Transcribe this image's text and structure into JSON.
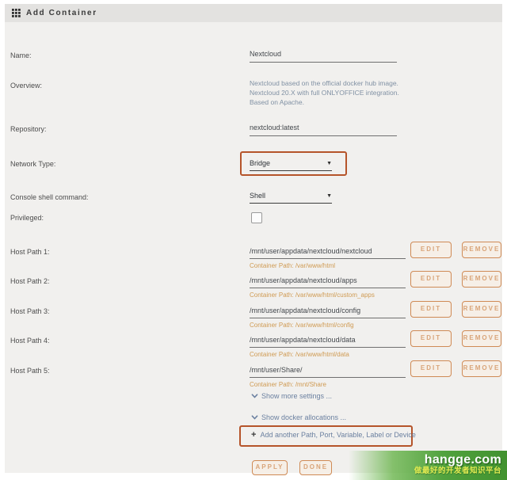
{
  "header": {
    "title": "Add Container"
  },
  "form": {
    "name": {
      "label": "Name:",
      "value": "Nextcloud"
    },
    "overview": {
      "label": "Overview:",
      "value": "Nextcloud based on the official docker hub image. Nextcloud 20.X with full ONLYOFFICE integration. Based on Apache."
    },
    "repository": {
      "label": "Repository:",
      "value": "nextcloud:latest"
    },
    "network_type": {
      "label": "Network Type:",
      "value": "Bridge"
    },
    "console_shell": {
      "label": "Console shell command:",
      "value": "Shell"
    },
    "privileged": {
      "label": "Privileged:",
      "checked": false
    }
  },
  "host_paths": [
    {
      "label": "Host Path 1:",
      "value": "/mnt/user/appdata/nextcloud/nextcloud",
      "container_path": "Container Path: /var/www/html"
    },
    {
      "label": "Host Path 2:",
      "value": "/mnt/user/appdata/nextcloud/apps",
      "container_path": "Container Path: /var/www/html/custom_apps"
    },
    {
      "label": "Host Path 3:",
      "value": "/mnt/user/appdata/nextcloud/config",
      "container_path": "Container Path: /var/www/html/config"
    },
    {
      "label": "Host Path 4:",
      "value": "/mnt/user/appdata/nextcloud/data",
      "container_path": "Container Path: /var/www/html/data"
    },
    {
      "label": "Host Path 5:",
      "value": "/mnt/user/Share/",
      "container_path": "Container Path: /mnt/Share"
    }
  ],
  "actions": {
    "edit": "EDIT",
    "remove": "REMOVE",
    "show_more_settings": "Show more settings ...",
    "show_docker_allocations": "Show docker allocations ...",
    "add_another": "Add another Path, Port, Variable, Label or Device",
    "apply": "APPLY",
    "done": "DONE"
  },
  "colors": {
    "highlight_border": "#b5542a",
    "button_border": "#cf8a55",
    "button_text": "#d9a478",
    "container_path_text": "#cf9a52",
    "link_text": "#6b80a0",
    "banner_green": "#41922f"
  },
  "watermark": {
    "title": "hangge.com",
    "subtitle": "做最好的开发者知识平台"
  }
}
